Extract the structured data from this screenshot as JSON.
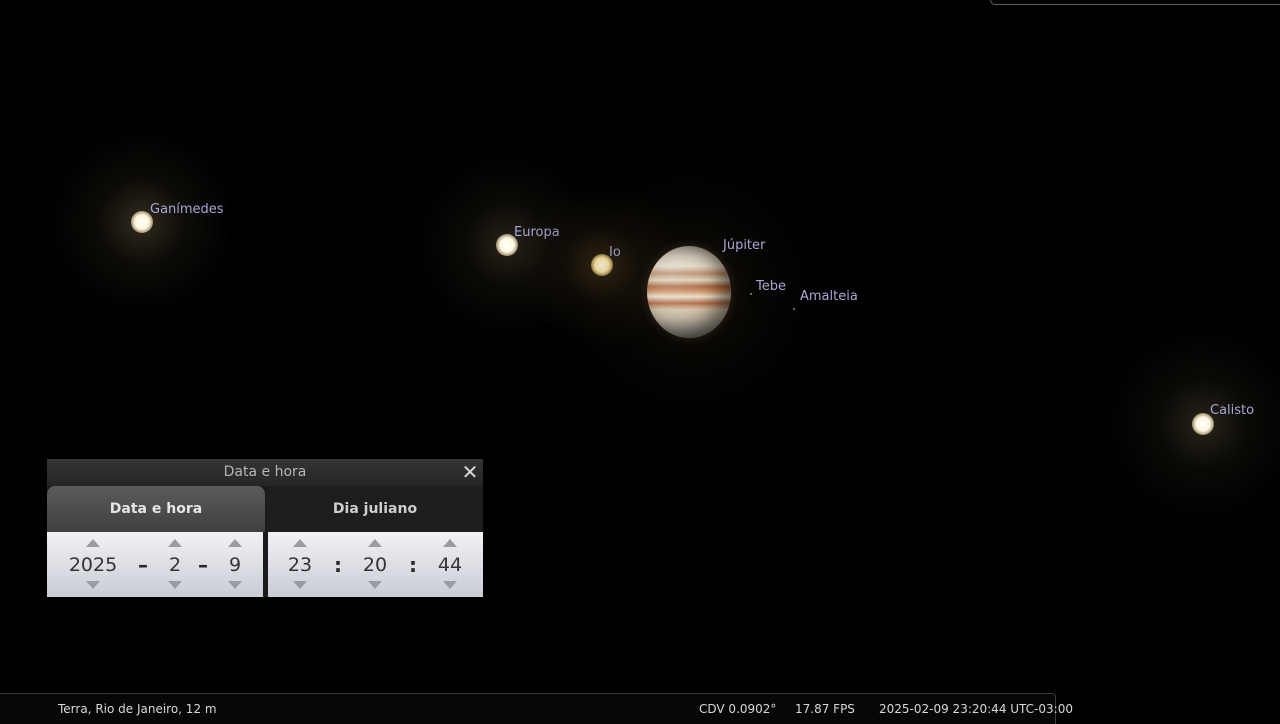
{
  "sky": {
    "objects": [
      {
        "key": "ganimedes",
        "label": "Ganímedes"
      },
      {
        "key": "europa",
        "label": "Europa"
      },
      {
        "key": "io",
        "label": "Io"
      },
      {
        "key": "jupiter",
        "label": "Júpiter"
      },
      {
        "key": "tebe",
        "label": "Tebe"
      },
      {
        "key": "amalteia",
        "label": "Amalteia"
      },
      {
        "key": "calisto",
        "label": "Calisto"
      }
    ],
    "label_color": "#a9a6d6"
  },
  "date_time_window": {
    "title": "Data e hora",
    "close_icon": "close-icon",
    "tabs": [
      {
        "label": "Data e hora",
        "active": true
      },
      {
        "label": "Dia juliano",
        "active": false
      }
    ],
    "date": {
      "year": "2025",
      "month": "2",
      "day": "9",
      "separator": "–"
    },
    "time": {
      "hour": "23",
      "minute": "20",
      "second": "44",
      "separator": ":"
    }
  },
  "status_bar": {
    "location": "Terra, Rio de Janeiro, 12 m",
    "fov": "CDV 0.0902°",
    "fps": "17.87 FPS",
    "datetime": "2025-02-09 23:20:44 UTC-03:00"
  }
}
